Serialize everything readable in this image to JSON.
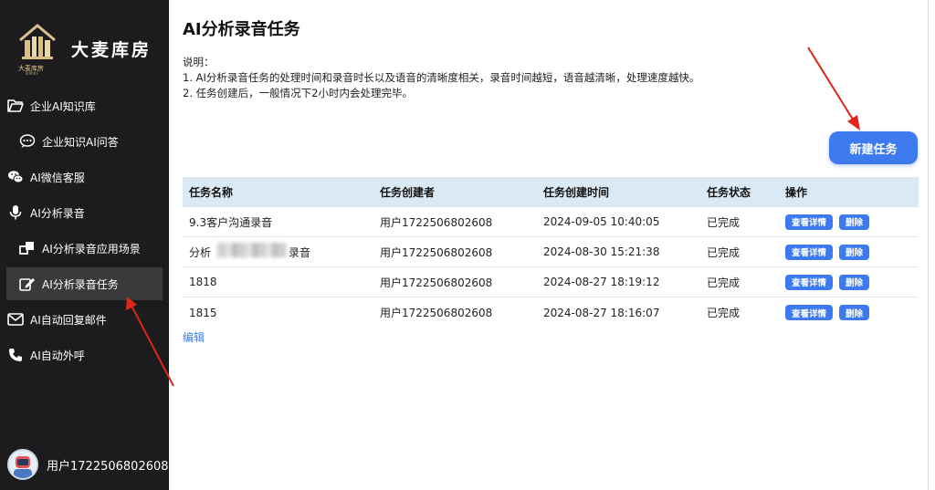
{
  "brand": {
    "name": "大麦库房",
    "logo_caption": "大麦库房",
    "logo_sub": "DMKF"
  },
  "sidebar": {
    "items": [
      {
        "label": "企业AI知识库",
        "icon": "folder-open-icon"
      },
      {
        "label": "企业知识AI问答",
        "icon": "chat-dots-icon"
      },
      {
        "label": "AI微信客服",
        "icon": "wechat-icon"
      },
      {
        "label": "AI分析录音",
        "icon": "microphone-icon"
      },
      {
        "label": "AI分析录音应用场景",
        "icon": "squares-icon"
      },
      {
        "label": "AI分析录音任务",
        "icon": "edit-icon"
      },
      {
        "label": "AI自动回复邮件",
        "icon": "envelope-icon"
      },
      {
        "label": "AI自动外呼",
        "icon": "phone-icon"
      }
    ],
    "active_item": "AI分析录音任务",
    "user": {
      "name": "用户1722506802608",
      "avatar": "robot-avatar"
    }
  },
  "main": {
    "title": "AI分析录音任务",
    "description": {
      "heading": "说明：",
      "line1": "1. AI分析录音任务的处理时间和录音时长以及语音的清晰度相关，录音时间越短，语音越清晰，处理速度越快。",
      "line2": "2. 任务创建后，一般情况下2小时内会处理完毕。"
    },
    "new_task_button": "新建任务",
    "table": {
      "headers": [
        "任务名称",
        "任务创建者",
        "任务创建时间",
        "任务状态",
        "操作"
      ],
      "rows": [
        {
          "name": "9.3客户沟通录音",
          "creator": "用户1722506802608",
          "created": "2024-09-05 10:40:05",
          "status": "已完成"
        },
        {
          "name": "分析 录音",
          "name_prefix": "分析",
          "name_suffix": "录音",
          "creator": "用户1722506802608",
          "created": "2024-08-30 15:21:38",
          "status": "已完成"
        },
        {
          "name": "1818",
          "creator": "用户1722506802608",
          "created": "2024-08-27 18:19:12",
          "status": "已完成"
        },
        {
          "name": "1815",
          "creator": "用户1722506802608",
          "created": "2024-08-27 18:16:07",
          "status": "已完成"
        }
      ],
      "actions": {
        "detail": "查看详情",
        "delete": "删除"
      }
    },
    "edit_link": "编辑"
  },
  "colors": {
    "sidebar_bg": "#1c1c1e",
    "accent": "#3d7af0",
    "table_header_bg": "#dbe9f4",
    "annotation_arrow": "#e0241b"
  }
}
